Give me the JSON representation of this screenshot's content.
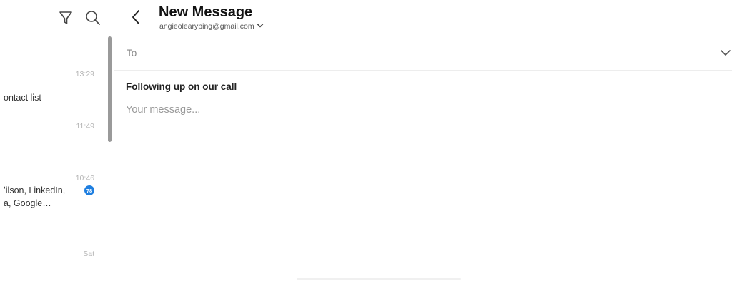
{
  "list_pane": {
    "toolbar": {
      "filter_icon": "filter-icon",
      "search_icon": "search-icon"
    },
    "items": [
      {
        "time": "13:29",
        "snippet_lines": [
          "ontact list"
        ]
      },
      {
        "time": "11:49",
        "snippet_lines": []
      },
      {
        "time": "10:46",
        "snippet_lines": [
          "ʼilson, LinkedIn,",
          "a, Google…"
        ],
        "badge": "78"
      },
      {
        "time": "Sat",
        "snippet_lines": []
      }
    ]
  },
  "compose": {
    "title": "New Message",
    "account": "angieolearyping@gmail.com",
    "to_label": "To",
    "subject": "Following up on our call",
    "body_placeholder": "Your message..."
  },
  "colors": {
    "badge": "#1f7fe0",
    "muted": "#b5b5b5"
  }
}
